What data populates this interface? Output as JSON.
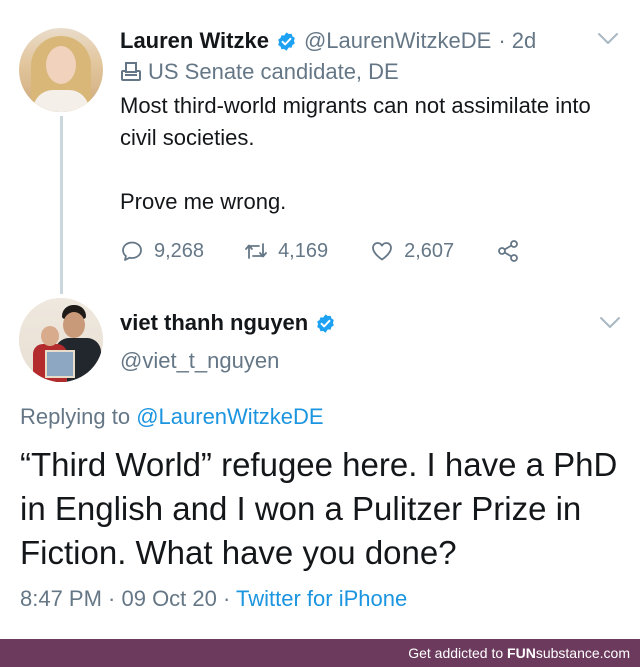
{
  "tweet1": {
    "name": "Lauren Witzke",
    "handle": "@LaurenWitzkeDE",
    "time": "· 2d",
    "label": "US Senate candidate, DE",
    "text": "Most third-world migrants can not assimilate into civil societies.\n\nProve me wrong.",
    "replies": "9,268",
    "retweets": "4,169",
    "likes": "2,607"
  },
  "tweet2": {
    "name": "viet thanh nguyen",
    "handle": "@viet_t_nguyen",
    "replying_prefix": "Replying to",
    "replying_to": "@LaurenWitzkeDE",
    "text": "“Third World” refugee here. I have a PhD in English and I won a Pulitzer Prize in Fiction. What have you done?",
    "timestamp": "8:47 PM · 09 Oct 20 · ",
    "source": "Twitter for iPhone"
  },
  "footer": {
    "prefix": "Get addicted to ",
    "brand_fun": "FUN",
    "brand_rest": "substance",
    "suffix": ".com"
  },
  "colors": {
    "verified": "#1da1f2",
    "link": "#1b95e0",
    "muted": "#657786",
    "footer_bg": "#6b3a5c"
  },
  "icons": {
    "verified": "verified-badge-icon",
    "label": "ballot-box-icon",
    "reply": "reply-icon",
    "retweet": "retweet-icon",
    "like": "heart-icon",
    "share": "share-icon",
    "menu": "chevron-down-icon"
  }
}
